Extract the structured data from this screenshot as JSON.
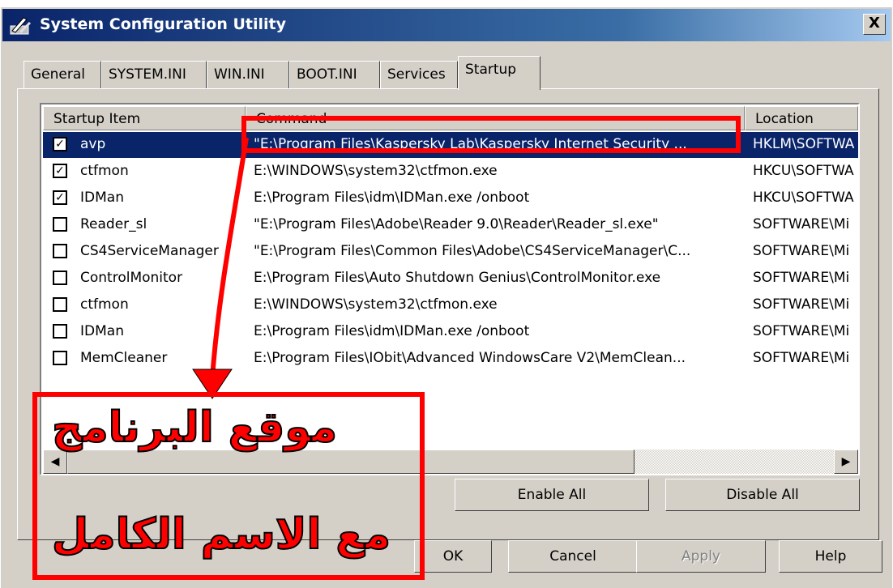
{
  "window": {
    "title": "System Configuration Utility",
    "close_glyph": "X"
  },
  "tabs": [
    "General",
    "SYSTEM.INI",
    "WIN.INI",
    "BOOT.INI",
    "Services",
    "Startup"
  ],
  "active_tab": "Startup",
  "columns": {
    "item": "Startup Item",
    "command": "Command",
    "location": "Location"
  },
  "rows": [
    {
      "name": "avp",
      "checked": true,
      "selected": true,
      "command": "\"E:\\Program Files\\Kaspersky Lab\\Kaspersky Internet Security ...",
      "location": "HKLM\\SOFTWA"
    },
    {
      "name": "ctfmon",
      "checked": true,
      "command": "E:\\WINDOWS\\system32\\ctfmon.exe",
      "location": "HKCU\\SOFTWA"
    },
    {
      "name": "IDMan",
      "checked": true,
      "command": "E:\\Program Files\\idm\\IDMan.exe /onboot",
      "location": "HKCU\\SOFTWA"
    },
    {
      "name": "Reader_sl",
      "checked": false,
      "command": "\"E:\\Program Files\\Adobe\\Reader 9.0\\Reader\\Reader_sl.exe\"",
      "location": "SOFTWARE\\Mi"
    },
    {
      "name": "CS4ServiceManager",
      "checked": false,
      "command": "\"E:\\Program Files\\Common Files\\Adobe\\CS4ServiceManager\\C...",
      "location": "SOFTWARE\\Mi"
    },
    {
      "name": "ControlMonitor",
      "checked": false,
      "command": "E:\\Program Files\\Auto Shutdown Genius\\ControlMonitor.exe",
      "location": "SOFTWARE\\Mi"
    },
    {
      "name": "ctfmon",
      "checked": false,
      "command": "E:\\WINDOWS\\system32\\ctfmon.exe",
      "location": "SOFTWARE\\Mi"
    },
    {
      "name": "IDMan",
      "checked": false,
      "command": "E:\\Program Files\\idm\\IDMan.exe /onboot",
      "location": "SOFTWARE\\Mi"
    },
    {
      "name": "MemCleaner",
      "checked": false,
      "command": "E:\\Program Files\\IObit\\Advanced WindowsCare V2\\MemClean...",
      "location": "SOFTWARE\\Mi"
    }
  ],
  "buttons": {
    "enable_all": "Enable All",
    "disable_all": "Disable All",
    "ok": "OK",
    "cancel": "Cancel",
    "apply": "Apply",
    "help": "Help"
  },
  "annotation": {
    "line1": "موقع البرنامج",
    "line2": "مع الاسم الكامل",
    "color": "#ff0000"
  },
  "colors": {
    "titlebar": "#0a246a",
    "selection": "#0a246a",
    "face": "#d4d0c8"
  }
}
